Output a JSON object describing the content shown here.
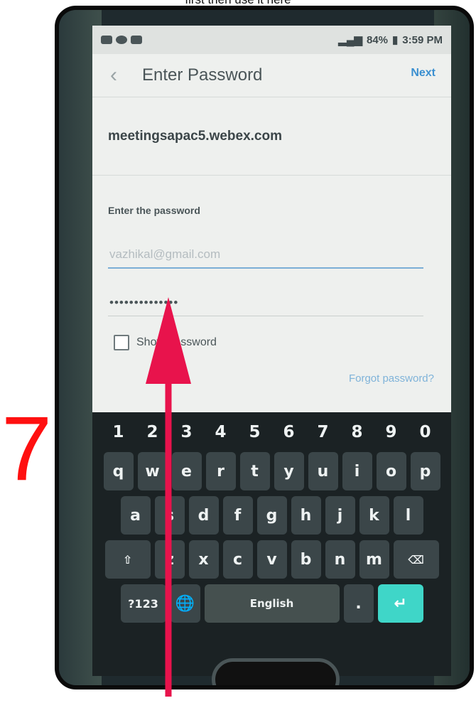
{
  "caption": "first then use it here",
  "step_number": "7",
  "status_bar": {
    "battery": "84%",
    "time": "3:59 PM"
  },
  "header": {
    "back_icon": "chevron-left-icon",
    "title": "Enter Password",
    "next_label": "Next"
  },
  "site": "meetingsapac5.webex.com",
  "form": {
    "label": "Enter the password",
    "email_value": "vazhikal@gmail.com",
    "password_value": "••••••••••••••",
    "show_password_label": "Show password",
    "forgot_label": "Forgot password?"
  },
  "keyboard": {
    "row_numbers": [
      "1",
      "2",
      "3",
      "4",
      "5",
      "6",
      "7",
      "8",
      "9",
      "0"
    ],
    "row1": [
      "q",
      "w",
      "e",
      "r",
      "t",
      "y",
      "u",
      "i",
      "o",
      "p"
    ],
    "row2": [
      "a",
      "s",
      "d",
      "f",
      "g",
      "h",
      "j",
      "k",
      "l"
    ],
    "row3": [
      "z",
      "x",
      "c",
      "v",
      "b",
      "n",
      "m"
    ],
    "symbols_label": "?123",
    "space_label": "English",
    "period_label": "."
  },
  "colors": {
    "annotation_red": "#ff1010",
    "arrow": "#e8134c",
    "link_blue": "#3a8fd0",
    "enter_key": "#3fd6c8"
  }
}
